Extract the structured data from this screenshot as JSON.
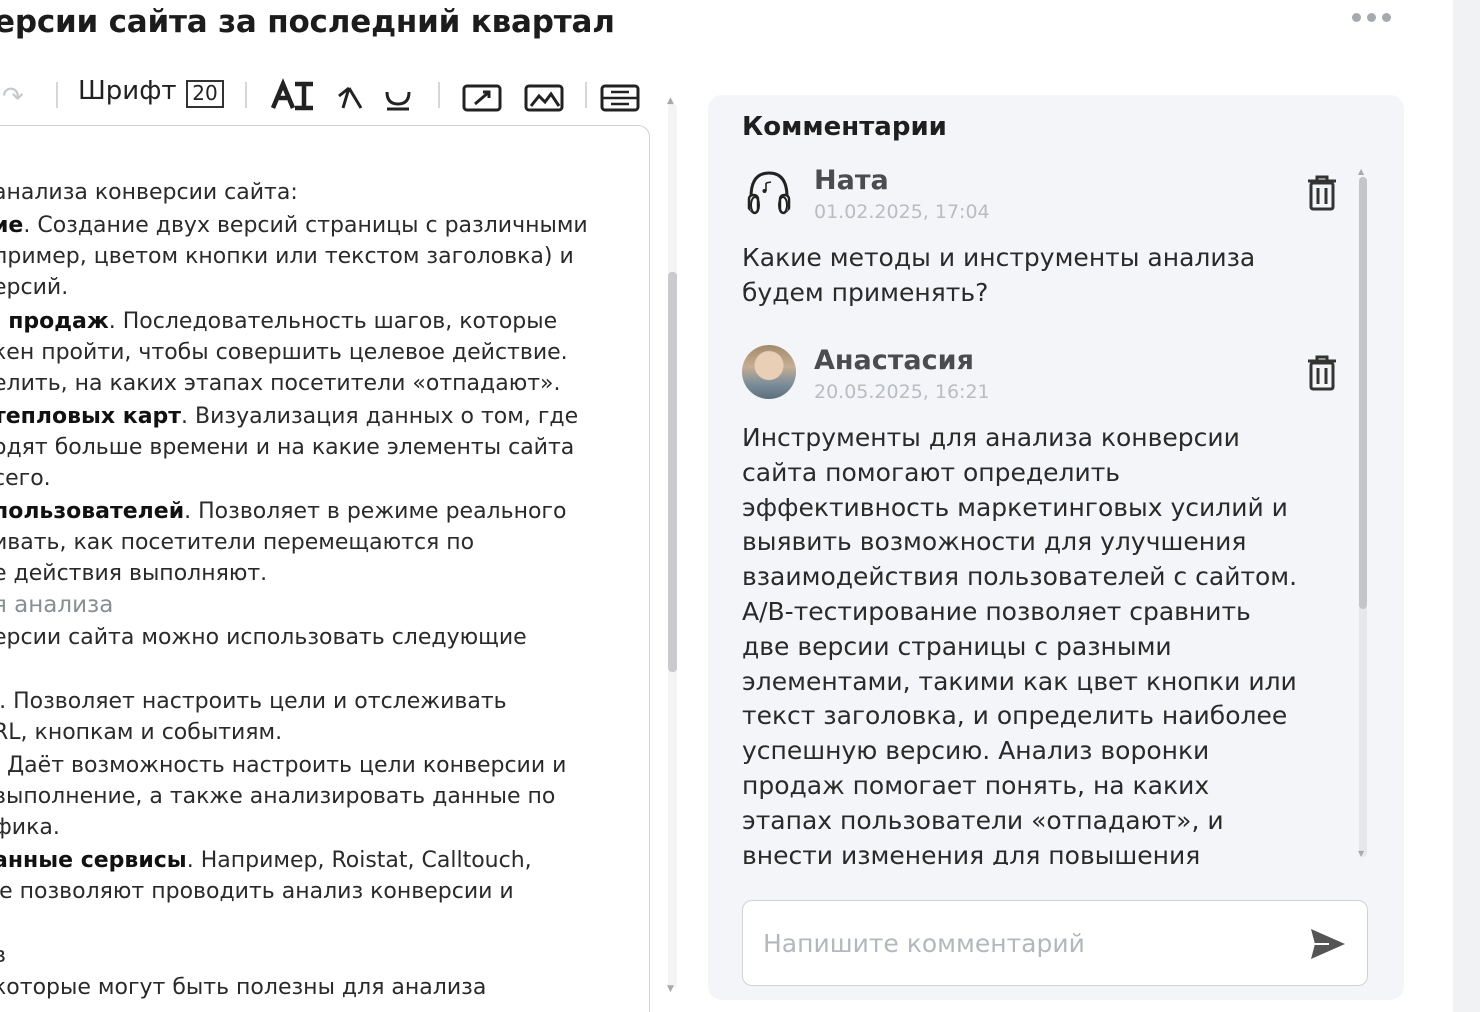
{
  "header": {
    "title": "ерсии сайта за последний квартал",
    "more_icon": "more-horizontal-icon"
  },
  "toolbar": {
    "font_label": "Шрифт",
    "font_size": "20"
  },
  "editor": {
    "lines": [
      {
        "segments": [
          {
            "t": "ı",
            "b": false
          }
        ]
      },
      {
        "segments": [
          {
            "t": " анализа конверсии сайта:",
            "b": false
          }
        ]
      },
      {
        "segments": [
          {
            "t": "ие",
            "b": true
          },
          {
            "t": ". Создание двух версий страницы с различными",
            "b": false
          }
        ]
      },
      {
        "segments": [
          {
            "t": "пример, цветом кнопки или текстом заголовка) и",
            "b": false
          }
        ]
      },
      {
        "segments": [
          {
            "t": "ерсий.",
            "b": false
          }
        ]
      },
      {
        "segments": [
          {
            "t": "ı продаж",
            "b": true
          },
          {
            "t": ". Последовательность шагов, которые",
            "b": false
          }
        ]
      },
      {
        "segments": [
          {
            "t": "кен пройти, чтобы совершить целевое действие.",
            "b": false
          }
        ]
      },
      {
        "segments": [
          {
            "t": "елить, на каких этапах посетители «отпадают».",
            "b": false
          }
        ]
      },
      {
        "segments": [
          {
            "t": "тепловых карт",
            "b": true
          },
          {
            "t": ". Визуализация данных о том, где",
            "b": false
          }
        ]
      },
      {
        "segments": [
          {
            "t": "одят больше времени и на какие элементы сайта",
            "b": false
          }
        ]
      },
      {
        "segments": [
          {
            "t": "сего.",
            "b": false
          }
        ]
      },
      {
        "segments": [
          {
            "t": "пользователей",
            "b": true
          },
          {
            "t": ". Позволяет в режиме реального",
            "b": false
          }
        ]
      },
      {
        "segments": [
          {
            "t": "ивать, как посетители перемещаются по",
            "b": false
          }
        ]
      },
      {
        "segments": [
          {
            "t": "е действия выполняют.",
            "b": false
          }
        ]
      },
      {
        "heading": true,
        "segments": [
          {
            "t": "я анализа",
            "b": false
          }
        ]
      },
      {
        "segments": [
          {
            "t": "ерсии сайта можно использовать следующие",
            "b": false
          }
        ]
      },
      {
        "segments": [
          {
            "t": "",
            "b": false
          }
        ]
      },
      {
        "segments": [
          {
            "t": "ı. Позволяет настроить цели и отслеживать",
            "b": false
          }
        ]
      },
      {
        "segments": [
          {
            "t": "RL, кнопкам и событиям.",
            "b": false
          }
        ]
      },
      {
        "segments": [
          {
            "t": ". Даёт возможность настроить цели конверсии и",
            "b": false
          }
        ]
      },
      {
        "segments": [
          {
            "t": "выполнение, а также анализировать данные по",
            "b": false
          }
        ]
      },
      {
        "segments": [
          {
            "t": "фика.",
            "b": false
          }
        ]
      },
      {
        "segments": [
          {
            "t": "анные сервисы",
            "b": true
          },
          {
            "t": ". Например, Roistat, Calltouch,",
            "b": false
          }
        ]
      },
      {
        "segments": [
          {
            "t": "ıе позволяют проводить анализ конверсии и",
            "b": false
          }
        ]
      },
      {
        "segments": [
          {
            "t": "",
            "b": false
          }
        ]
      },
      {
        "segments": [
          {
            "t": "в",
            "b": false
          }
        ]
      },
      {
        "segments": [
          {
            "t": " которые могут быть полезны для анализа",
            "b": false
          }
        ]
      }
    ]
  },
  "comments": {
    "title": "Комментарии",
    "items": [
      {
        "author": "Ната",
        "date": "01.02.2025, 17:04",
        "avatar": "headphones-avatar",
        "lines": [
          "Какие методы и инструменты анализа",
          "будем применять?"
        ]
      },
      {
        "author": "Анастасия",
        "date": "20.05.2025, 16:21",
        "avatar": "photo-avatar",
        "lines": [
          "Инструменты для анализа конверсии",
          "сайта помогают определить",
          "эффективность маркетинговых усилий и",
          "выявить возможности для улучшения",
          "взаимодействия пользователей с сайтом.",
          "A/B-тестирование позволяет сравнить",
          "две версии страницы с разными",
          "элементами, такими как цвет кнопки или",
          "текст заголовка, и определить наиболее",
          "успешную версию. Анализ воронки",
          "продаж помогает понять, на каких",
          "этапах пользователи «отпадают», и",
          "внести изменения для повышения"
        ]
      }
    ],
    "input_placeholder": "Напишите комментарий",
    "input_value": ""
  },
  "icons": {
    "delete": "trash-icon",
    "send": "send-icon"
  },
  "colors": {
    "panel_bg": "#f4f5f8",
    "border": "#cfd2d6",
    "muted_text": "#b9bcc1"
  }
}
